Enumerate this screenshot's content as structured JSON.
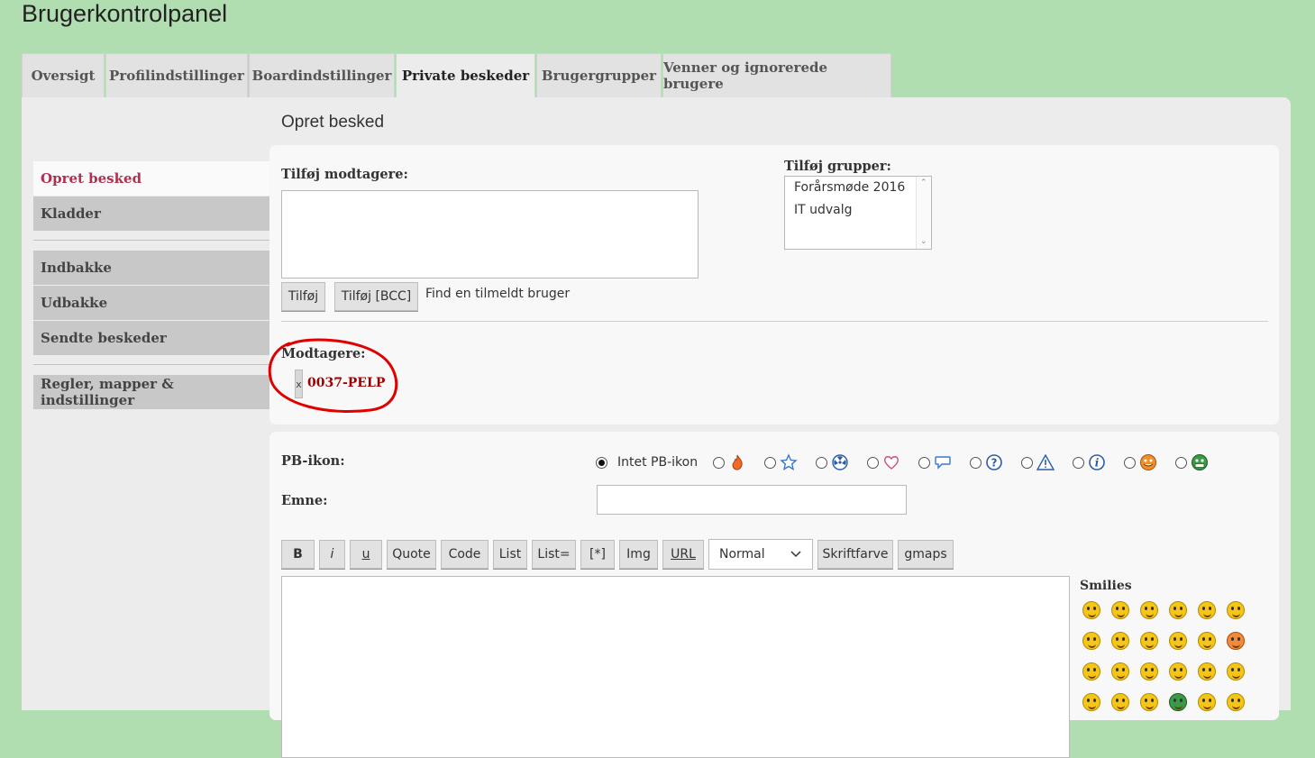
{
  "page_title": "Brugerkontrolpanel",
  "tabs": [
    {
      "label": "Oversigt"
    },
    {
      "label": "Profilindstillinger"
    },
    {
      "label": "Boardindstillinger"
    },
    {
      "label": "Private beskeder"
    },
    {
      "label": "Brugergrupper"
    },
    {
      "label": "Venner og ignorerede brugere"
    }
  ],
  "active_tab": "Private beskeder",
  "sidebar": {
    "items": [
      {
        "label": "Opret besked",
        "active": true
      },
      {
        "label": "Kladder"
      },
      {
        "label": "Indbakke"
      },
      {
        "label": "Udbakke"
      },
      {
        "label": "Sendte beskeder"
      },
      {
        "label": "Regler, mapper & indstillinger"
      }
    ]
  },
  "section_title": "Opret besked",
  "recipients": {
    "add_label": "Tilføj modtagere:",
    "add_button": "Tilføj",
    "add_bcc_button": "Tilføj [BCC]",
    "find_link": "Find en tilmeldt bruger",
    "groups_label": "Tilføj grupper:",
    "groups": [
      "Forårsmøde 2016",
      "IT udvalg"
    ],
    "list_label": "Modtagere:",
    "remove_glyph": "x",
    "list": [
      "0037-PELP"
    ]
  },
  "compose": {
    "pm_icon_label": "PB-ikon:",
    "no_icon_label": "Intet PB-ikon",
    "pm_icons": [
      "fire-icon",
      "star-icon",
      "radioactive-icon",
      "heart-icon",
      "speech-bubble-icon",
      "question-icon",
      "warning-icon",
      "info-icon",
      "mrgreen-icon",
      "sick-icon"
    ],
    "subject_label": "Emne:",
    "subject_value": "",
    "toolbar": {
      "bold": "B",
      "italic": "i",
      "underline": "u",
      "quote": "Quote",
      "code": "Code",
      "list": "List",
      "list_eq": "List=",
      "list_item": "[*]",
      "img": "Img",
      "url": "URL",
      "size_value": "Normal",
      "font_color": "Skriftfarve",
      "gmaps": "gmaps"
    },
    "message_value": "",
    "smilies_title": "Smilies"
  },
  "colors": {
    "background": "#b0deb0",
    "panel": "#ececec",
    "active_sidebar_text": "#b03050",
    "recipient_name": "#a00000",
    "annotation_circle": "#e00000"
  }
}
